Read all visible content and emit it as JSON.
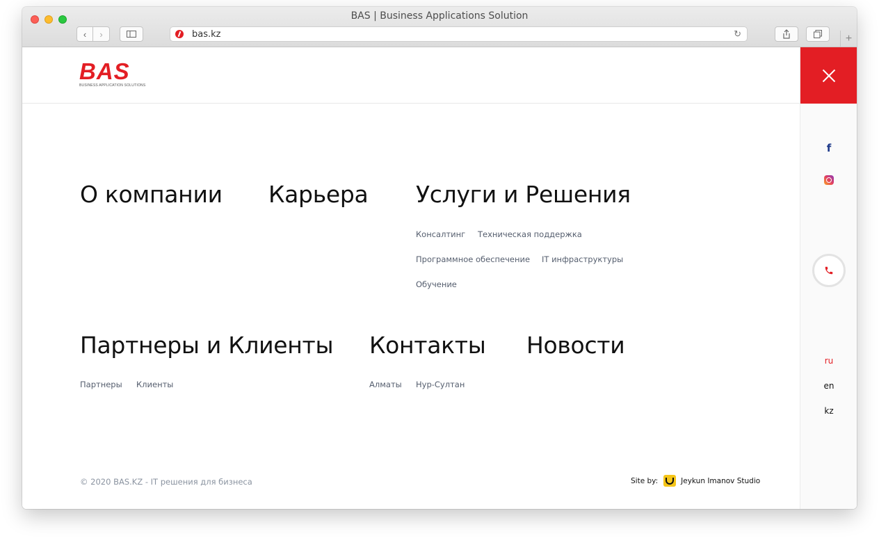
{
  "browser": {
    "window_title": "BAS | Business Applications Solution",
    "address": "bas.kz",
    "back_icon": "chevron-left-icon",
    "forward_icon": "chevron-right-icon",
    "reload_icon": "reload-icon"
  },
  "header": {
    "logo_text": "BAS",
    "logo_subtitle": "BUSINESS APPLICATION SOLUTIONS"
  },
  "menu": {
    "about": "О компании",
    "career": "Карьера",
    "services": {
      "title": "Услуги и Решения",
      "items": [
        "Консалтинг",
        "Техническая поддержка",
        "Программное обеспечение",
        "IT инфраструктуры",
        "Обучение"
      ]
    },
    "partners": {
      "title": "Партнеры и Клиенты",
      "items": [
        "Партнеры",
        "Клиенты"
      ]
    },
    "contacts": {
      "title": "Контакты",
      "items": [
        "Алматы",
        "Нур-Султан"
      ]
    },
    "news": "Новости"
  },
  "rail": {
    "facebook": "f",
    "languages": [
      "ru",
      "en",
      "kz"
    ],
    "active_language": "ru"
  },
  "footer": {
    "copyright": "© 2020 BAS.KZ - IT решения для бизнеса",
    "site_by_label": "Site by:",
    "studio": "Jeykun Imanov Studio"
  },
  "colors": {
    "brand": "#e31e24",
    "text": "#111111",
    "muted": "#555e6e"
  }
}
